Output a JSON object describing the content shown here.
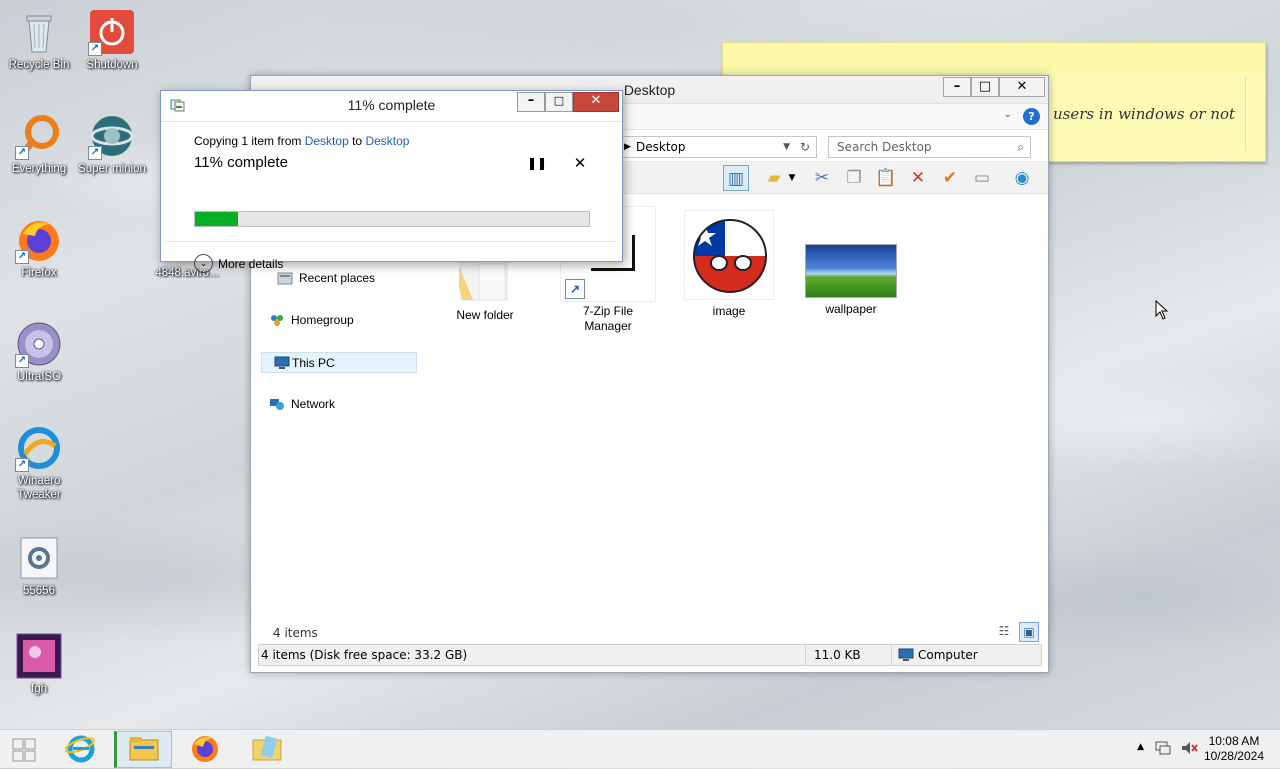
{
  "desktop": {
    "icons": [
      {
        "label": "Recycle Bin"
      },
      {
        "label": "Shutdown"
      },
      {
        "label": "Everything"
      },
      {
        "label": "Super minion"
      },
      {
        "label": "Firefox"
      },
      {
        "label": "4848.aviro..."
      },
      {
        "label": "UltraISO"
      },
      {
        "label": "Winaero Tweaker"
      },
      {
        "label": "55656"
      },
      {
        "label": "fgh"
      }
    ]
  },
  "sticky_note": {
    "text": "users in windows or not"
  },
  "explorer": {
    "title": "Desktop",
    "address": "Desktop",
    "search_placeholder": "Search Desktop",
    "nav": {
      "recent_places": "Recent places",
      "homegroup": "Homegroup",
      "this_pc": "This PC",
      "network": "Network"
    },
    "files": [
      {
        "name": "New folder"
      },
      {
        "name": "7-Zip File Manager"
      },
      {
        "name": "image"
      },
      {
        "name": "wallpaper"
      }
    ],
    "item_count": "4 items",
    "status": {
      "summary": "4 items (Disk free space: 33.2 GB)",
      "size": "11.0 KB",
      "location": "Computer"
    }
  },
  "copy_dialog": {
    "title": "11% complete",
    "copying_prefix": "Copying 1 item from",
    "from": "Desktop",
    "to_word": "to",
    "to": "Desktop",
    "percent_label": "11% complete",
    "progress": 0.11,
    "more_details": "More details"
  },
  "taskbar": {
    "time": "10:08 AM",
    "date": "10/28/2024"
  },
  "colors": {
    "progress_fill": "#06b025",
    "link": "#1e5ebf",
    "close_button": "#c7473c",
    "sticky_note": "#fdfbb5"
  }
}
